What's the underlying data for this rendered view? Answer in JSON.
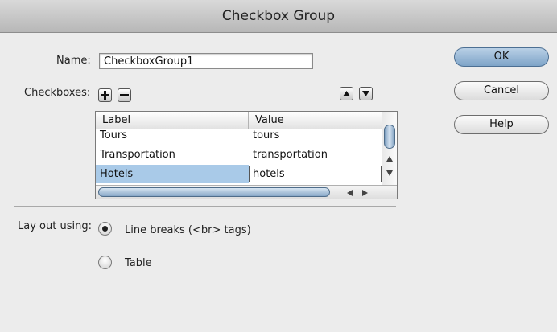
{
  "window": {
    "title": "Checkbox Group"
  },
  "form": {
    "name_label": "Name:",
    "name_value": "CheckboxGroup1",
    "checkboxes_label": "Checkboxes:"
  },
  "buttons": {
    "ok": "OK",
    "cancel": "Cancel",
    "help": "Help"
  },
  "table": {
    "columns": [
      "Label",
      "Value"
    ],
    "rows": [
      {
        "label": "Tours",
        "value": "tours"
      },
      {
        "label": "Transportation",
        "value": "transportation"
      },
      {
        "label": "Hotels",
        "value": "hotels"
      }
    ]
  },
  "layout": {
    "label": "Lay out using:",
    "options": [
      {
        "label": "Line breaks (<br> tags)",
        "selected": true
      },
      {
        "label": "Table",
        "selected": false
      }
    ]
  },
  "colors": {
    "selection": "#a9cae8",
    "default_button": "#8fb1d2"
  }
}
